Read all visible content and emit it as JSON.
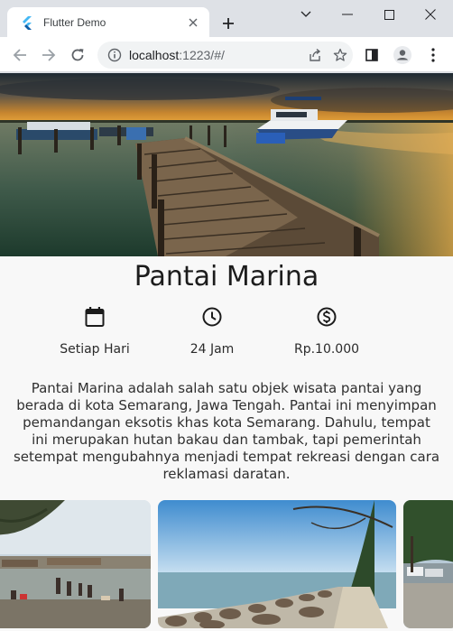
{
  "browser": {
    "tab_title": "Flutter Demo",
    "url_host": "localhost",
    "url_rest": ":1223/#/"
  },
  "page": {
    "title": "Pantai Marina",
    "info": [
      {
        "icon": "calendar-icon",
        "text": "Setiap Hari"
      },
      {
        "icon": "clock-icon",
        "text": "24 Jam"
      },
      {
        "icon": "dollar-icon",
        "text": "Rp.10.000"
      }
    ],
    "description": "Pantai Marina adalah salah satu objek wisata pantai yang berada di kota Semarang, Jawa Tengah. Pantai ini menyimpan pemandangan eksotis khas kota Semarang. Dahulu, tempat ini merupakan hutan bakau dan tambak, tapi pemerintah setempat mengubahnya menjadi tempat rekreasi dengan cara reklamasi daratan.",
    "gallery": [
      "beach-crowd-photo",
      "rocky-breakwater-photo",
      "parking-area-photo"
    ]
  },
  "colors": {
    "chrome_bg": "#dee1e6",
    "page_bg": "#f8f8f8",
    "flutter_blue": "#45b8f4"
  }
}
